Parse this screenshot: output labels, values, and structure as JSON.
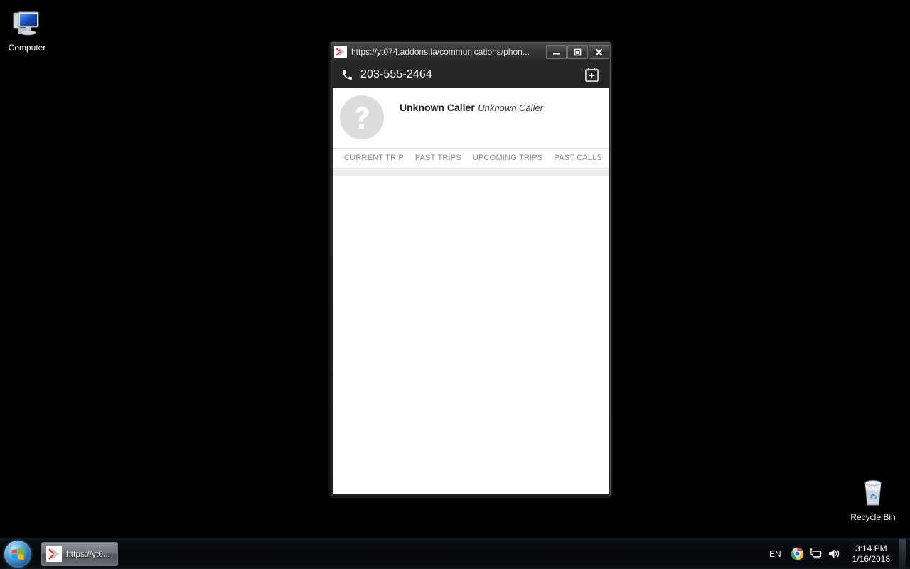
{
  "desktop": {
    "icons": [
      {
        "name": "computer",
        "label": "Computer",
        "icon": "computer-monitor-icon"
      },
      {
        "name": "recycle-bin",
        "label": "Recycle Bin",
        "icon": "recycle-bin-icon"
      }
    ]
  },
  "window": {
    "title": "https://yt074.addons.la/communications/phon...",
    "favicon": "page-icon",
    "controls": {
      "minimize": "minimize-icon",
      "maximize": "maximize-icon",
      "close": "close-icon"
    }
  },
  "app": {
    "header": {
      "phone_icon": "phone-icon",
      "phone_number": "203-555-2464",
      "add_event_icon": "calendar-plus-icon"
    },
    "caller": {
      "avatar_icon": "question-mark-avatar-icon",
      "name": "Unknown Caller",
      "subtitle": "Unknown Caller"
    },
    "tabs": [
      {
        "id": "current-trip",
        "label": "CURRENT TRIP",
        "active": true
      },
      {
        "id": "past-trips",
        "label": "PAST TRIPS",
        "active": false
      },
      {
        "id": "upcoming-trips",
        "label": "UPCOMING TRIPS",
        "active": false
      },
      {
        "id": "past-calls",
        "label": "PAST CALLS",
        "active": false
      }
    ],
    "content": ""
  },
  "taskbar": {
    "start_label": "Start",
    "buttons": [
      {
        "name": "browser",
        "label": "https://yt0...",
        "icon": "page-icon"
      }
    ],
    "tray": {
      "language": "EN",
      "icons": [
        {
          "name": "chrome-icon"
        },
        {
          "name": "network-icon"
        },
        {
          "name": "volume-icon"
        }
      ],
      "time": "3:14 PM",
      "date": "1/16/2018"
    }
  },
  "colors": {
    "app_header_bg": "#262626",
    "desktop_bg": "#000000",
    "tab_text": "#8c8c8c",
    "avatar_bg": "#dcdcdc"
  }
}
